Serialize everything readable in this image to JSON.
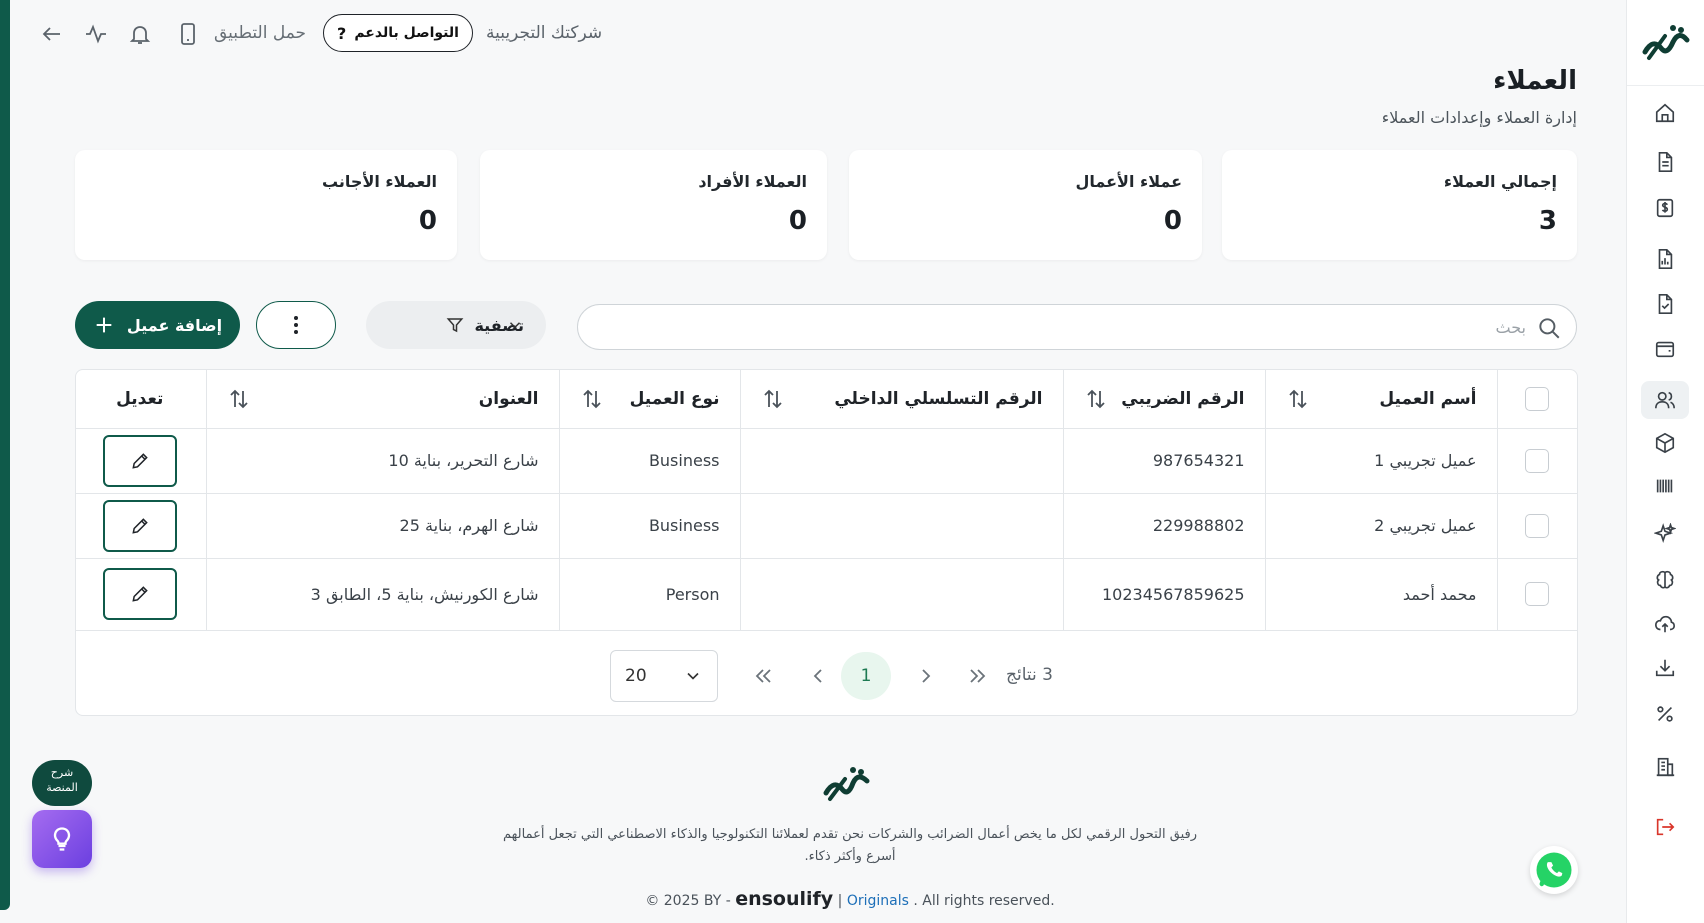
{
  "topbar": {
    "company": "شركتك التجريبية",
    "support_label": "التواصل بالدعم",
    "download_app": "حمل التطبيق"
  },
  "header": {
    "title": "العملاء",
    "subtitle": "إدارة العملاء وإعدادات العملاء"
  },
  "stats": [
    {
      "label": "إجمالي العملاء",
      "value": "3"
    },
    {
      "label": "عملاء الأعمال",
      "value": "0"
    },
    {
      "label": "العملاء الأفراد",
      "value": "0"
    },
    {
      "label": "العملاء الأجانب",
      "value": "0"
    }
  ],
  "toolbar": {
    "search_placeholder": "بحث",
    "filter_label": "تصفية",
    "add_label": "إضافة عميل"
  },
  "table": {
    "columns": [
      "أسم العميل",
      "الرقم الضريبي",
      "الرقم التسلسلي الداخلي",
      "نوع العميل",
      "العنوان",
      "تعديل"
    ],
    "rows": [
      {
        "name": "عميل تجريبي 1",
        "tax": "987654321",
        "serial": "",
        "type": "Business",
        "address": "شارع التحرير، بناية 10"
      },
      {
        "name": "عميل تجريبي 2",
        "tax": "229988802",
        "serial": "",
        "type": "Business",
        "address": "شارع الهرم، بناية 25"
      },
      {
        "name": "محمد أحمد",
        "tax": "10234567859625",
        "serial": "",
        "type": "Person",
        "address": "شارع الكورنيش، بناية 5، الطابق 3"
      }
    ]
  },
  "pagination": {
    "results": "3 نتائج",
    "current_page": "1",
    "per_page": "20"
  },
  "footer": {
    "tagline_line1": "رفيق التحول الرقمي لكل ما يخص أعمال الضرائب والشركات نحن تقدم لعملائنا التكنولوجيا والذكاء الاصطناعي التي تجعل أعمالهم",
    "tagline_line2": "أسرع وأكثر ذكاء.",
    "copy_prefix": "© 2025 BY -",
    "brand": "ensoulify",
    "separator": "|",
    "originals": "Originals",
    "rights": ". All rights reserved."
  },
  "floating": {
    "help_line1": "شرح",
    "help_line2": "المنصة"
  },
  "colors": {
    "brand": "#0f5a4a",
    "accent_green": "#1d7a52",
    "idea_purple": "#8b55ea",
    "whatsapp": "#25d366"
  }
}
